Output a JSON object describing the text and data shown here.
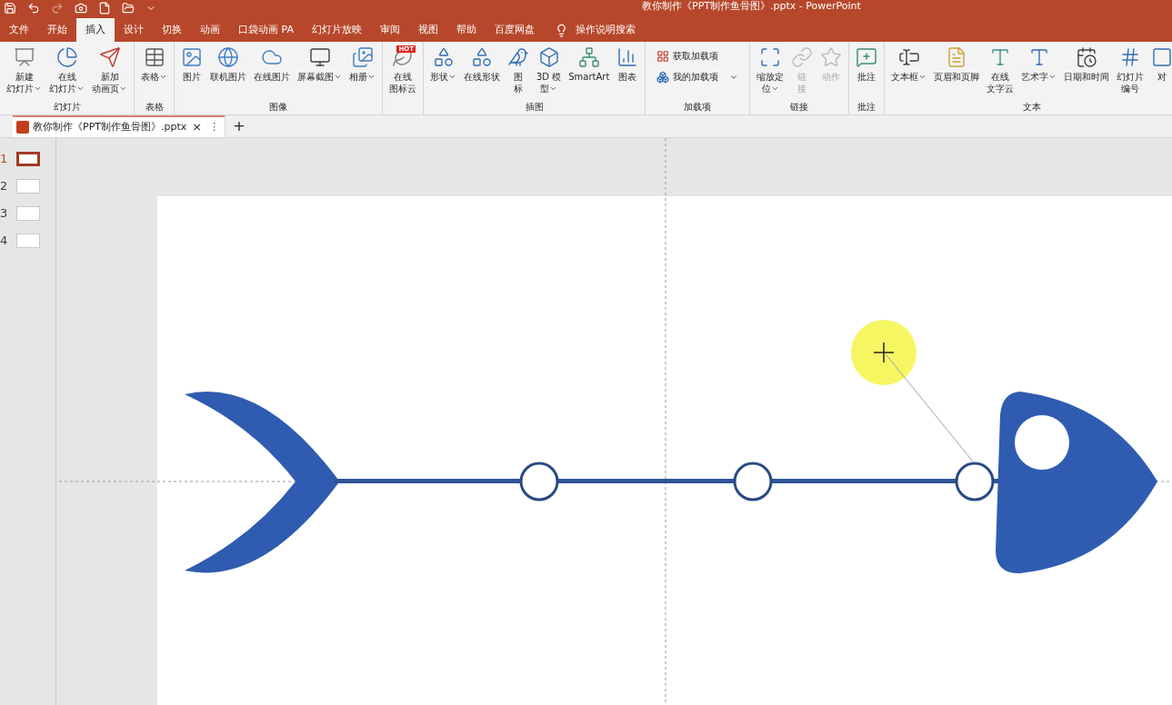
{
  "window": {
    "title": "教你制作《PPT制作鱼骨图》.pptx  -  PowerPoint"
  },
  "ribbon_tabs": [
    {
      "label": "文件",
      "selected": false
    },
    {
      "label": "开始",
      "selected": false
    },
    {
      "label": "插入",
      "selected": true
    },
    {
      "label": "设计",
      "selected": false
    },
    {
      "label": "切换",
      "selected": false
    },
    {
      "label": "动画",
      "selected": false
    },
    {
      "label": "口袋动画 PA",
      "selected": false
    },
    {
      "label": "幻灯片放映",
      "selected": false
    },
    {
      "label": "审阅",
      "selected": false
    },
    {
      "label": "视图",
      "selected": false
    },
    {
      "label": "帮助",
      "selected": false
    },
    {
      "label": "百度网盘",
      "selected": false
    }
  ],
  "tell_me": "操作说明搜索",
  "ribbon_groups": [
    {
      "label": "幻灯片",
      "items": [
        {
          "kind": "large",
          "lines": [
            "新建",
            "幻灯片"
          ],
          "caret": true,
          "disabled": false
        },
        {
          "kind": "large",
          "lines": [
            "在线",
            "幻灯片"
          ],
          "caret": true,
          "disabled": false
        },
        {
          "kind": "large",
          "lines": [
            "新加",
            "动画页"
          ],
          "caret": true,
          "disabled": false
        }
      ]
    },
    {
      "label": "表格",
      "items": [
        {
          "kind": "large",
          "lines": [
            "表格"
          ],
          "caret": true,
          "disabled": false
        }
      ]
    },
    {
      "label": "图像",
      "items": [
        {
          "kind": "large",
          "lines": [
            "图片"
          ],
          "caret": false,
          "disabled": false
        },
        {
          "kind": "large",
          "lines": [
            "联机图片"
          ],
          "caret": false,
          "disabled": false
        },
        {
          "kind": "large",
          "lines": [
            "在线图片"
          ],
          "caret": false,
          "disabled": false
        },
        {
          "kind": "large",
          "lines": [
            "屏幕截图"
          ],
          "caret": true,
          "disabled": false
        },
        {
          "kind": "large",
          "lines": [
            "相册"
          ],
          "caret": true,
          "disabled": false
        }
      ]
    },
    {
      "items": [
        {
          "kind": "large",
          "lines": [
            "在线",
            "图标云"
          ],
          "caret": false,
          "disabled": false,
          "badge": "HOT"
        }
      ]
    },
    {
      "label": "插图",
      "items": [
        {
          "kind": "large",
          "lines": [
            "形状"
          ],
          "caret": true,
          "disabled": false
        },
        {
          "kind": "large",
          "lines": [
            "在线形状"
          ],
          "caret": false,
          "disabled": false
        },
        {
          "kind": "large",
          "lines": [
            "图",
            "标"
          ],
          "caret": false,
          "disabled": false
        },
        {
          "kind": "large",
          "lines": [
            "3D 模",
            "型"
          ],
          "caret": true,
          "disabled": false
        },
        {
          "kind": "large",
          "lines": [
            "SmartArt"
          ],
          "caret": false,
          "disabled": false
        },
        {
          "kind": "large",
          "lines": [
            "图表"
          ],
          "caret": false,
          "disabled": false
        }
      ]
    },
    {
      "label": "加载项",
      "items": [
        {
          "kind": "small",
          "lines": [
            "获取加载项"
          ],
          "caret": false,
          "disabled": false
        },
        {
          "kind": "small",
          "lines": [
            "我的加载项"
          ],
          "caret": true,
          "disabled": false
        }
      ]
    },
    {
      "label": "链接",
      "items": [
        {
          "kind": "large",
          "lines": [
            "缩放定",
            "位"
          ],
          "caret": true,
          "disabled": false
        },
        {
          "kind": "large",
          "lines": [
            "链",
            "接"
          ],
          "caret": false,
          "disabled": true
        },
        {
          "kind": "large",
          "lines": [
            "动作"
          ],
          "caret": false,
          "disabled": true
        }
      ]
    },
    {
      "label": "批注",
      "items": [
        {
          "kind": "large",
          "lines": [
            "批注"
          ],
          "caret": false,
          "disabled": false
        }
      ]
    },
    {
      "label": "文本",
      "items": [
        {
          "kind": "large",
          "lines": [
            "文本框"
          ],
          "caret": true,
          "disabled": false
        },
        {
          "kind": "large",
          "lines": [
            "页眉和页脚"
          ],
          "caret": false,
          "disabled": false
        },
        {
          "kind": "large",
          "lines": [
            "在线",
            "文字云"
          ],
          "caret": false,
          "disabled": false
        },
        {
          "kind": "large",
          "lines": [
            "艺术字"
          ],
          "caret": true,
          "disabled": false
        },
        {
          "kind": "large",
          "lines": [
            "日期和时间"
          ],
          "caret": false,
          "disabled": false
        },
        {
          "kind": "large",
          "lines": [
            "幻灯片",
            "编号"
          ],
          "caret": false,
          "disabled": false
        },
        {
          "kind": "large",
          "lines": [
            "对"
          ],
          "caret": false,
          "disabled": false
        }
      ]
    }
  ],
  "document_tab": {
    "label": "教你制作《PPT制作鱼骨图》.pptx",
    "close": "×",
    "more": "⋮",
    "new_tab": "+"
  },
  "slides": [
    {
      "number": "1",
      "selected": true
    },
    {
      "number": "2",
      "selected": false
    },
    {
      "number": "3",
      "selected": false
    },
    {
      "number": "4",
      "selected": false
    }
  ]
}
